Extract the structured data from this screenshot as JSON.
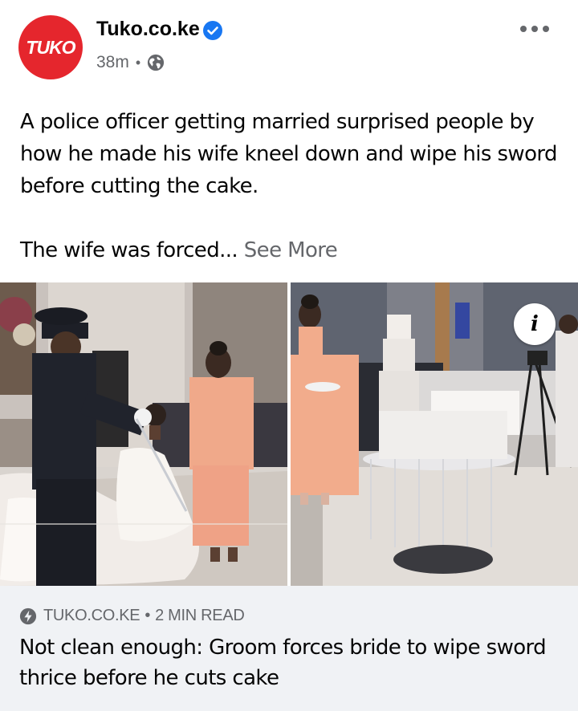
{
  "post": {
    "page_name": "Tuko.co.ke",
    "avatar_text": "TUKO",
    "timestamp": "38m",
    "separator": "•",
    "audience_icon": "globe-icon",
    "more_icon": "more-horizontal-icon",
    "verified_icon": "verified-badge-icon",
    "text_line1": "A police officer getting married surprised people by how he made his wife kneel down and wipe his sword before cutting the cake.",
    "text_line2": "The wife was forced...",
    "see_more": "See More"
  },
  "media": {
    "info_label": "i"
  },
  "link_card": {
    "source": "TUKO.CO.KE",
    "separator": "•",
    "read_time": "2 MIN READ",
    "source_icon": "lightning-bolt-icon",
    "title": "Not clean enough: Groom forces bride to wipe sword thrice before he cuts cake"
  },
  "colors": {
    "brand_red": "#e5262d",
    "verified_blue": "#1877f2",
    "secondary_text": "#65676b",
    "card_bg": "#f0f2f5"
  }
}
